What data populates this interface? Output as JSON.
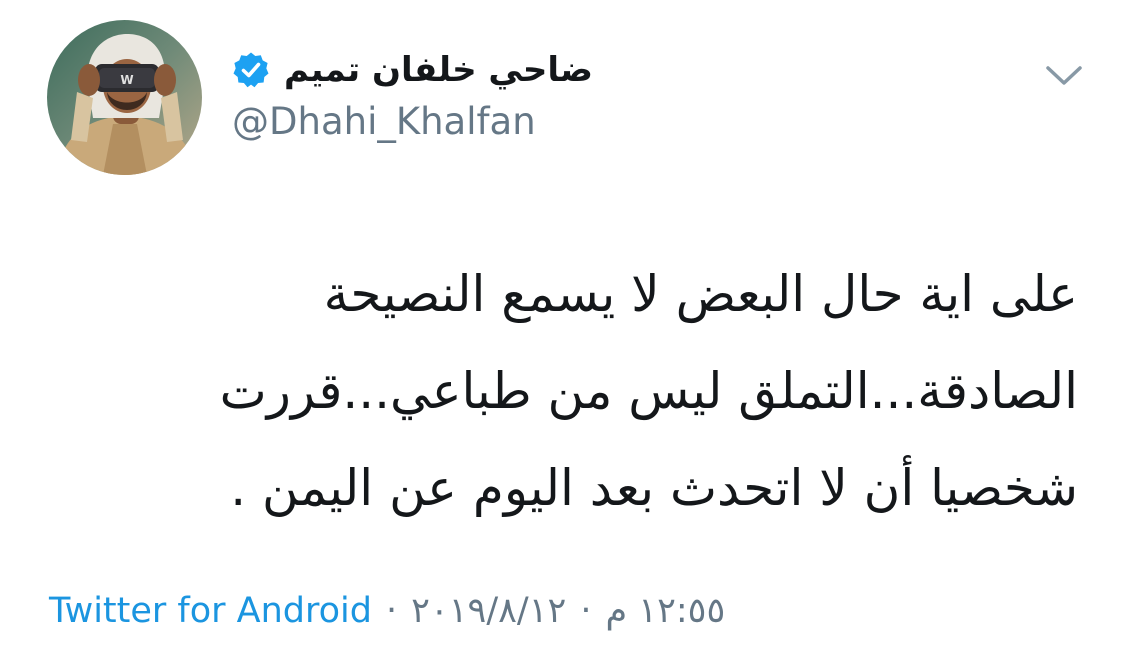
{
  "tweet": {
    "author": {
      "display_name": "ضاحي خلفان تميم",
      "handle": "@Dhahi_Khalfan",
      "verified_icon": "verified-badge-icon",
      "avatar_label": "W"
    },
    "menu_icon": "chevron-down-icon",
    "text_lines": [
      "على اية حال البعض لا يسمع النصيحة",
      "الصادقة...التملق ليس من طباعي...قررت",
      "شخصيا أن لا اتحدث بعد اليوم عن اليمن ."
    ],
    "meta": {
      "source": "Twitter for Android",
      "separator": "·",
      "date": "٢٠١٩/٨/١٢",
      "time": "١٢:٥٥ م"
    }
  },
  "colors": {
    "text": "#14171a",
    "secondary": "#657786",
    "link": "#1b95e0",
    "verified": "#1da1f2"
  }
}
